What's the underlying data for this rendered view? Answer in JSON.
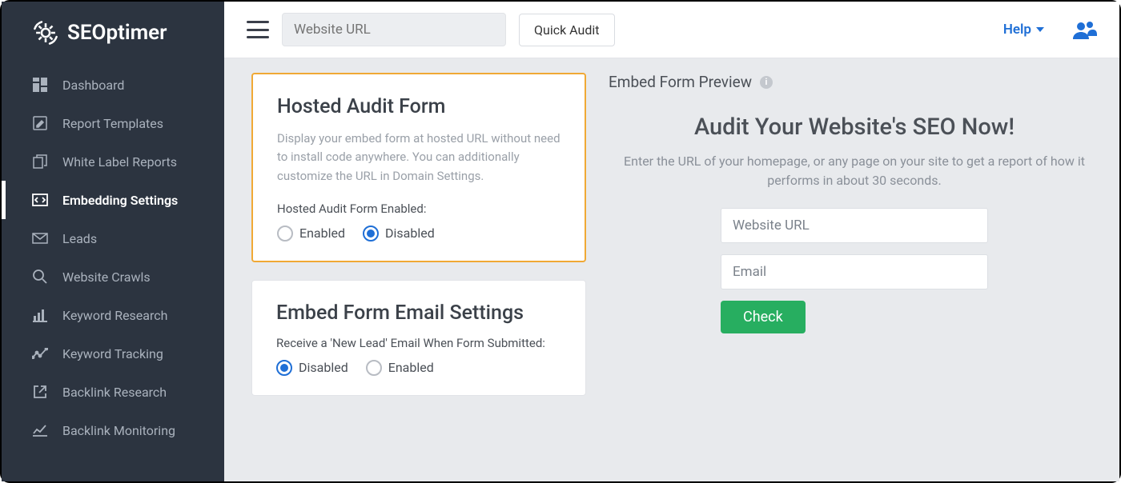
{
  "brand": "SEOptimer",
  "sidebar": {
    "items": [
      {
        "label": "Dashboard"
      },
      {
        "label": "Report Templates"
      },
      {
        "label": "White Label Reports"
      },
      {
        "label": "Embedding Settings"
      },
      {
        "label": "Leads"
      },
      {
        "label": "Website Crawls"
      },
      {
        "label": "Keyword Research"
      },
      {
        "label": "Keyword Tracking"
      },
      {
        "label": "Backlink Research"
      },
      {
        "label": "Backlink Monitoring"
      }
    ]
  },
  "topbar": {
    "url_placeholder": "Website URL",
    "quick_audit": "Quick Audit",
    "help": "Help"
  },
  "hosted_card": {
    "title": "Hosted Audit Form",
    "desc": "Display your embed form at hosted URL without need to install code anywhere. You can additionally customize the URL in Domain Settings.",
    "sublabel": "Hosted Audit Form Enabled:",
    "opt_enabled": "Enabled",
    "opt_disabled": "Disabled"
  },
  "email_card": {
    "title": "Embed Form Email Settings",
    "sublabel": "Receive a 'New Lead' Email When Form Submitted:",
    "opt_disabled": "Disabled",
    "opt_enabled": "Enabled"
  },
  "preview": {
    "header": "Embed Form Preview",
    "title": "Audit Your Website's SEO Now!",
    "lead": "Enter the URL of your homepage, or any page on your site to get a report of how it performs in about 30 seconds.",
    "url_placeholder": "Website URL",
    "email_placeholder": "Email",
    "check": "Check"
  }
}
